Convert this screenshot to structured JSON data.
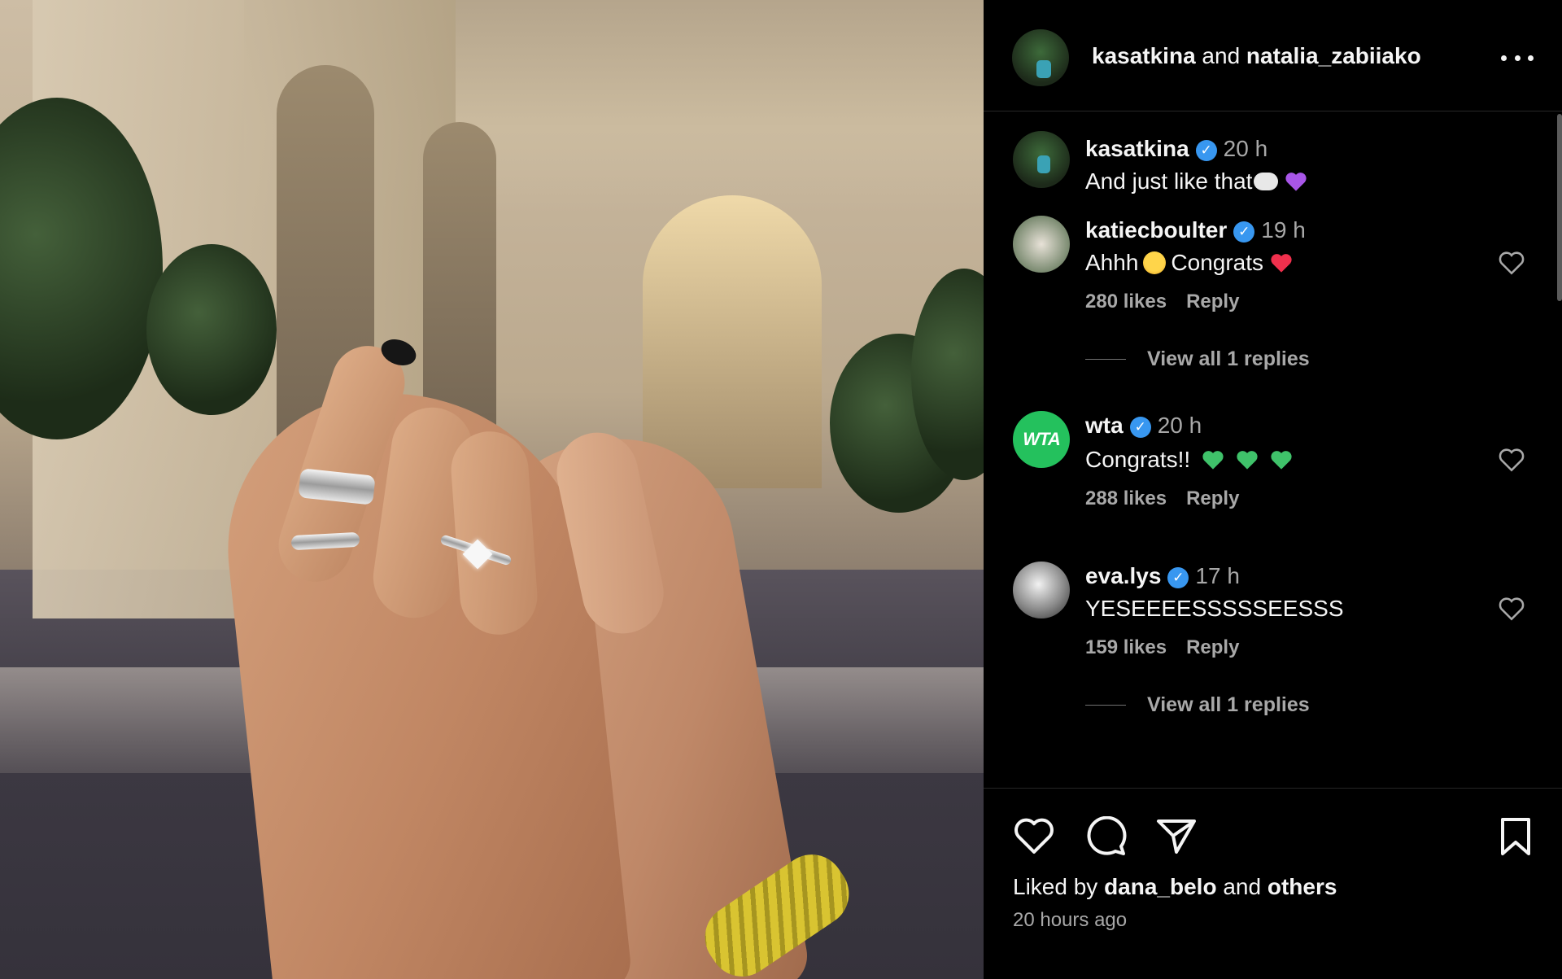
{
  "post": {
    "header": {
      "author": "kasatkina",
      "connector": "and",
      "collaborator": "natalia_zabiiako",
      "menu_icon": "more-horizontal-icon"
    },
    "comments": [
      {
        "username": "kasatkina",
        "verified": true,
        "time": "20 h",
        "text": "And just like that",
        "emojis": [
          "thought-bubble-emoji",
          "purple-heart-emoji"
        ]
      },
      {
        "username": "katiecboulter",
        "verified": true,
        "time": "19 h",
        "text_before": "Ahhh",
        "text_after": "Congrats",
        "emojis": [
          "face-holding-back-tears-emoji",
          "red-heart-emoji"
        ],
        "likes": "280 likes",
        "reply_label": "Reply",
        "view_replies": "View all 1 replies"
      },
      {
        "username": "wta",
        "avatar_text": "WTA",
        "verified": true,
        "time": "20 h",
        "text": "Congrats!!",
        "emojis": [
          "green-heart-emoji",
          "green-heart-emoji",
          "green-heart-emoji"
        ],
        "likes": "288 likes",
        "reply_label": "Reply"
      },
      {
        "username": "eva.lys",
        "verified": true,
        "time": "17 h",
        "text": "YESEEEESSSSSEESSS",
        "likes": "159 likes",
        "reply_label": "Reply",
        "view_replies": "View all 1 replies"
      }
    ],
    "footer": {
      "liked_by_prefix": "Liked by",
      "liked_by_user": "dana_belo",
      "liked_by_and": "and",
      "liked_by_others": "others",
      "posted_time": "20 hours ago",
      "icons": [
        "heart-icon",
        "comment-icon",
        "share-icon",
        "bookmark-icon"
      ]
    },
    "colors": {
      "background": "#000000",
      "text": "#f5f5f5",
      "muted": "#a8a8a8",
      "verified": "#3897f0",
      "wta_green": "#24c15d"
    }
  }
}
